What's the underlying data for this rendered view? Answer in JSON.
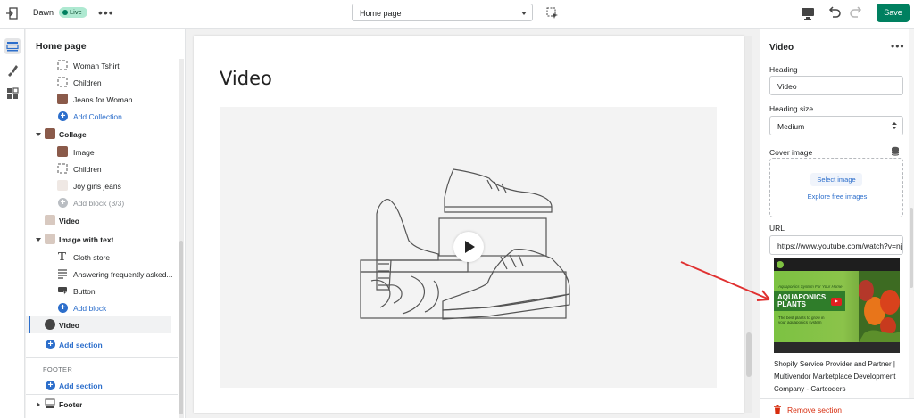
{
  "topbar": {
    "theme_name": "Dawn",
    "status_badge": "Live",
    "page_selector": "Home page",
    "save_label": "Save"
  },
  "sidebar": {
    "title": "Home page",
    "items": [
      {
        "label": "Woman Tshirt"
      },
      {
        "label": "Children"
      },
      {
        "label": "Jeans for Woman"
      },
      {
        "label": "Add Collection"
      },
      {
        "label": "Collage"
      },
      {
        "label": "Image"
      },
      {
        "label": "Children"
      },
      {
        "label": "Joy girls jeans"
      },
      {
        "label": "Add block (3/3)"
      },
      {
        "label": "Video"
      },
      {
        "label": "Image with text"
      },
      {
        "label": "Cloth store"
      },
      {
        "label": "Answering frequently asked..."
      },
      {
        "label": "Button"
      },
      {
        "label": "Add block"
      },
      {
        "label": "Video"
      },
      {
        "label": "Add section"
      }
    ],
    "footer_group_label": "FOOTER",
    "footer_add_section": "Add section",
    "footer_item": "Footer"
  },
  "canvas": {
    "section_heading": "Video"
  },
  "settings": {
    "title": "Video",
    "heading_label": "Heading",
    "heading_value": "Video",
    "heading_size_label": "Heading size",
    "heading_size_value": "Medium",
    "cover_image_label": "Cover image",
    "select_image": "Select image",
    "explore_free_images": "Explore free images",
    "url_label": "URL",
    "url_value": "https://www.youtube.com/watch?v=nj",
    "video_title": "Shopify Service Provider and Partner | Multivendor Marketplace Development Company - Cartcoders",
    "thumbnail": {
      "tagline": "Aquaponics System For Your Home",
      "title_line1": "AQUAPONICS",
      "title_line2": "PLANTS",
      "subtitle": "The best plants to grow in your aquaponics system"
    },
    "remove_section": "Remove section"
  },
  "colors": {
    "accent_blue": "#2c6ecb",
    "save_green": "#008060",
    "remove_red": "#d72c0d",
    "annotation_arrow": "#e03030"
  }
}
